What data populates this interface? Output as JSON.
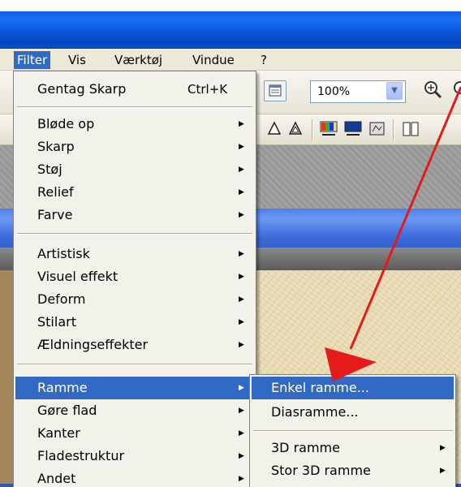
{
  "menubar": {
    "items": [
      {
        "label": "Filter",
        "active": true
      },
      {
        "label": "Vis"
      },
      {
        "label": "Værktøj"
      },
      {
        "label": "Vindue"
      },
      {
        "label": "?"
      }
    ]
  },
  "toolbar": {
    "zoom_value": "100%",
    "icons": [
      "window-icon",
      "zoom-dropdown-icon",
      "zoom-in-icon",
      "zoom-out-icon"
    ]
  },
  "filter_menu": {
    "repeat": {
      "label": "Gentag Skarp",
      "shortcut": "Ctrl+K"
    },
    "group1": [
      "Bløde op",
      "Skarp",
      "Støj",
      "Relief",
      "Farve"
    ],
    "group2": [
      "Artistisk",
      "Visuel effekt",
      "Deform",
      "Stilart",
      "Ældningseffekter"
    ],
    "group3": [
      "Ramme",
      "Gøre flad",
      "Kanter",
      "Fladestruktur",
      "Andet"
    ],
    "highlighted": "Ramme"
  },
  "ramme_submenu": {
    "items": [
      "Enkel ramme...",
      "Diasramme..."
    ],
    "items3d": [
      "3D ramme",
      "Stor 3D ramme"
    ],
    "highlighted": "Enkel ramme..."
  },
  "colors": {
    "highlight": "#316ac5",
    "annotation_arrow": "#e41b1b",
    "menu_bg": "#f2f1ea"
  }
}
